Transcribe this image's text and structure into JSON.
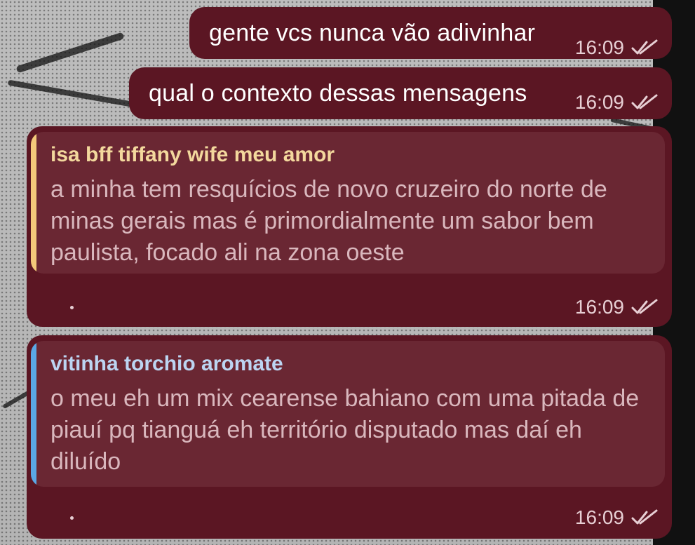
{
  "colors": {
    "bubble": "#5b1623",
    "reply_card": "#6a2733",
    "reply_text": "#d9b7bd",
    "meta_text": "#e7cfd4",
    "author_1": "#f3d89d",
    "accent_1": "#f3c87a",
    "author_2": "#bcd5f2",
    "accent_2": "#5aa7e6"
  },
  "messages": [
    {
      "text": "gente vcs nunca vão adivinhar",
      "time": "16:09",
      "status_icon": "double-check-icon"
    },
    {
      "text": "qual o contexto dessas mensagens",
      "time": "16:09",
      "status_icon": "double-check-icon"
    },
    {
      "reply": {
        "author": "isa bff tiffany wife meu amor",
        "body": "a minha tem resquícios de novo cruzeiro do norte de minas gerais mas é primordialmente um sabor bem paulista, focado ali na zona oeste"
      },
      "text": ".",
      "time": "16:09",
      "status_icon": "double-check-icon"
    },
    {
      "reply": {
        "author": "vitinha torchio aromate",
        "body": "o meu eh um mix cearense bahiano com uma pitada de piauí pq tianguá eh território disputado mas daí eh diluído"
      },
      "text": ".",
      "time": "16:09",
      "status_icon": "double-check-icon"
    }
  ]
}
